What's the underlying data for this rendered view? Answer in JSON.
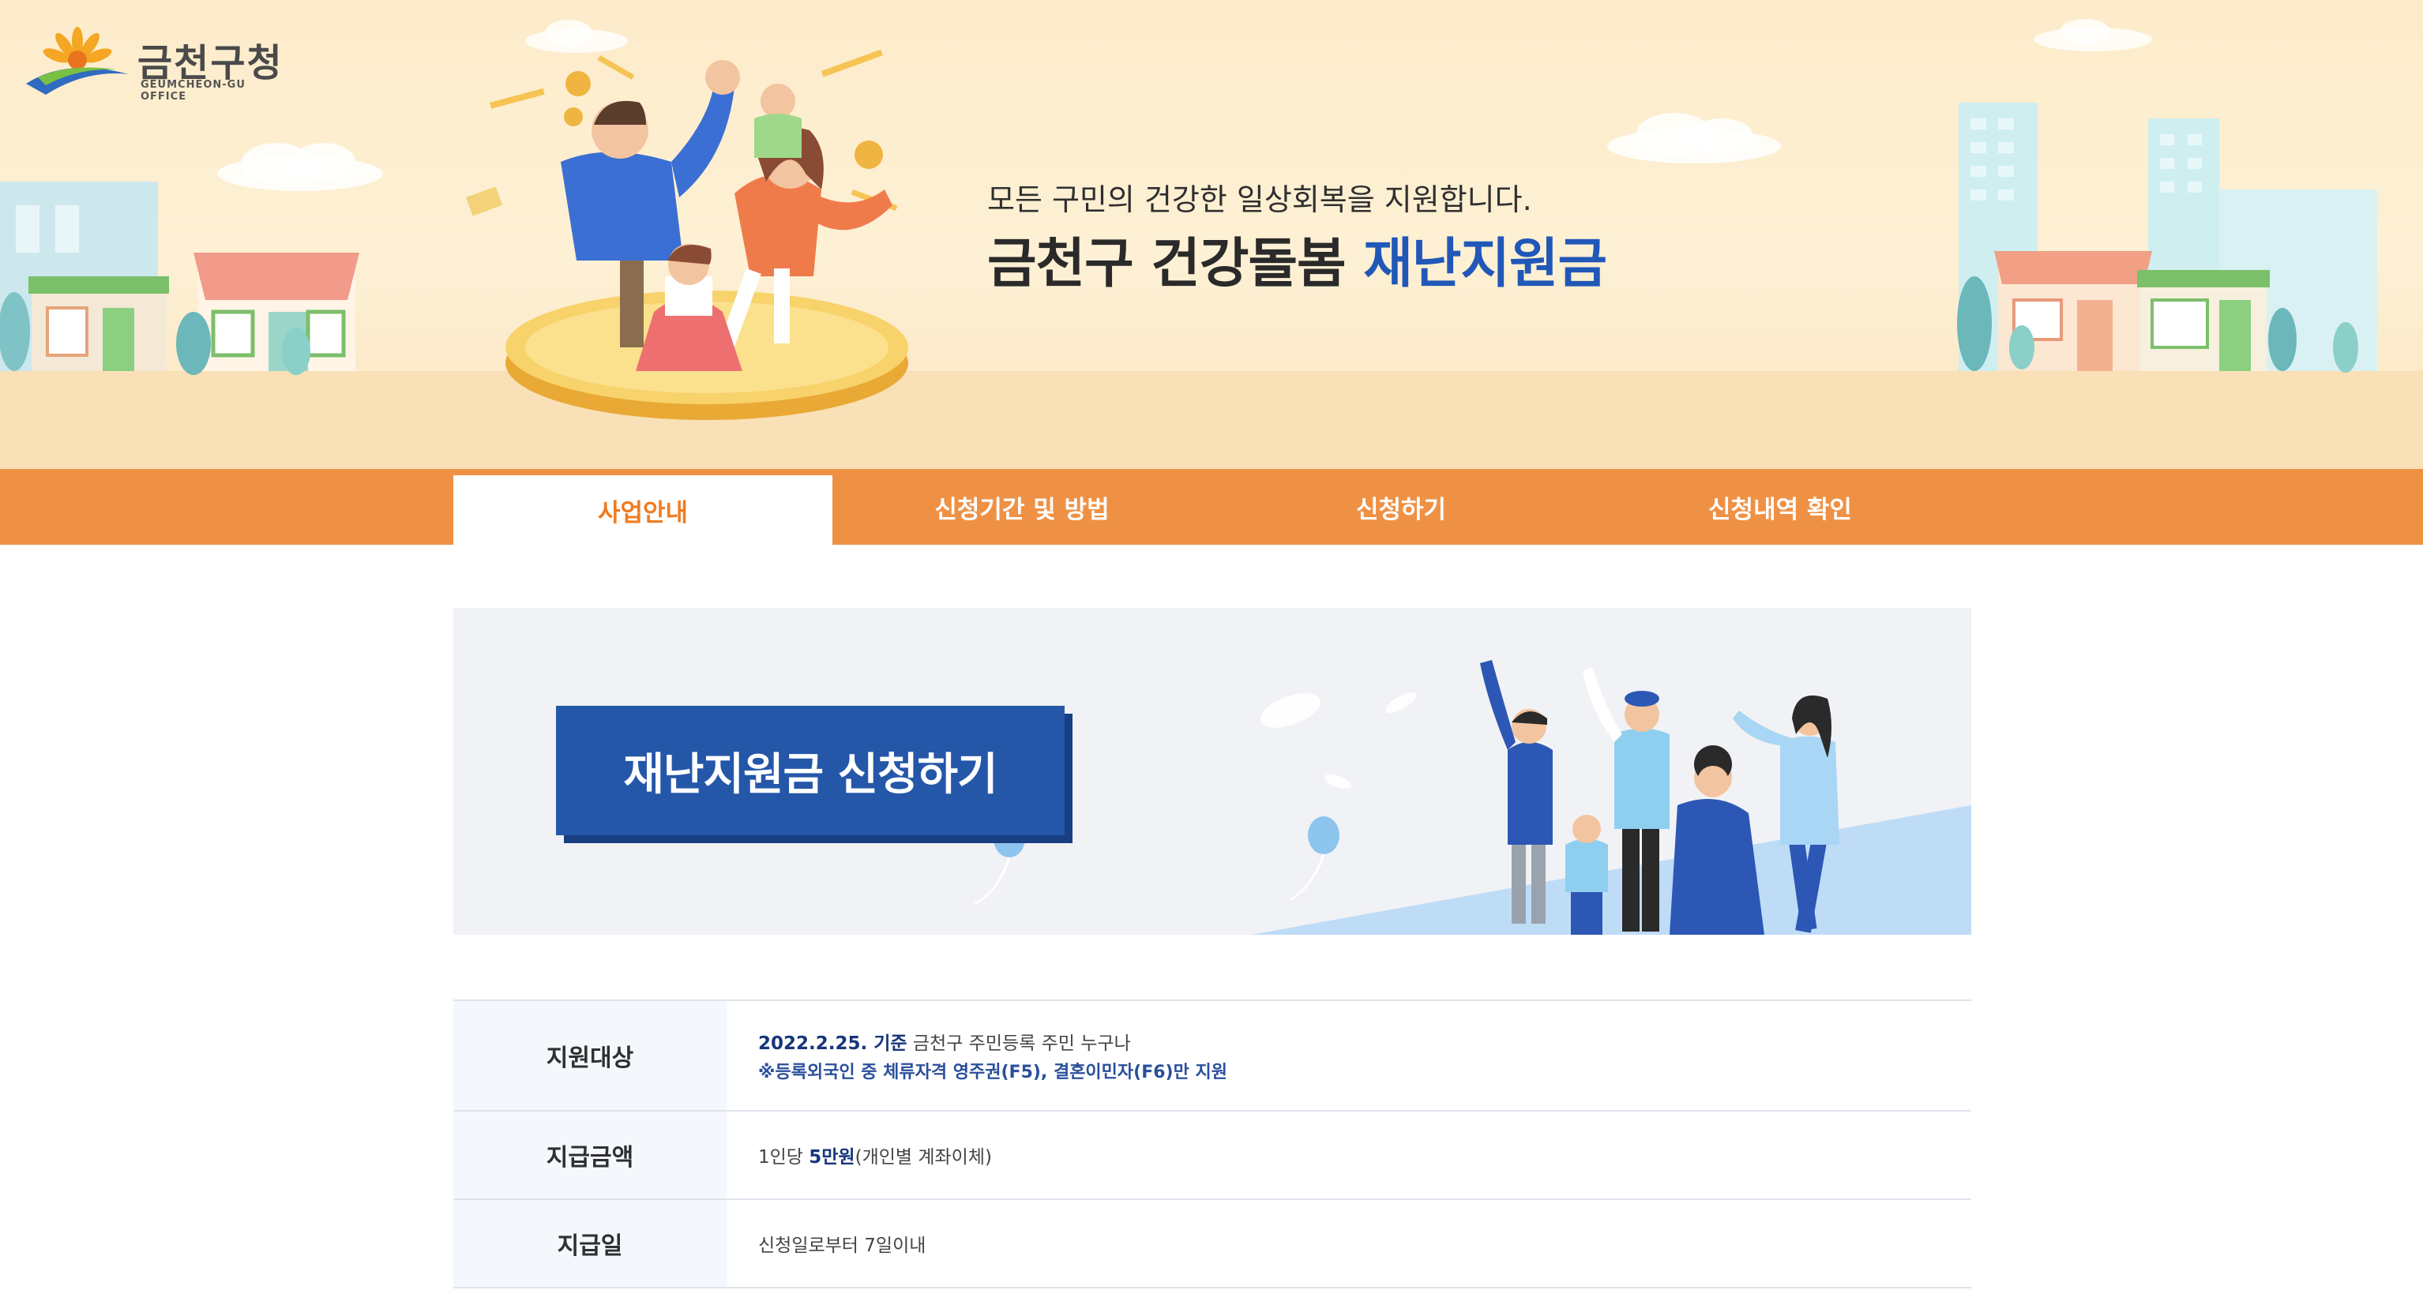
{
  "logo": {
    "title": "금천구청",
    "subtitle": "GEUMCHEON-GU OFFICE"
  },
  "hero": {
    "subtitle": "모든 구민의 건강한 일상회복을 지원합니다.",
    "title_prefix": "금천구 건강돌봄 ",
    "title_accent": "재난지원금"
  },
  "nav": {
    "tabs": [
      {
        "label": "사업안내",
        "active": true
      },
      {
        "label": "신청기간 및 방법",
        "active": false
      },
      {
        "label": "신청하기",
        "active": false
      },
      {
        "label": "신청내역 확인",
        "active": false
      }
    ]
  },
  "banner": {
    "apply_button": "재난지원금 신청하기"
  },
  "info": {
    "rows": [
      {
        "label": "지원대상",
        "line1_strong": "2022.2.25. 기준",
        "line1_rest": " 금천구 주민등록 주민 누구나",
        "line2": "※등록외국인 중 체류자격 영주권(F5), 결혼이민자(F6)만 지원"
      },
      {
        "label": "지급금액",
        "prefix": "1인당 ",
        "strong": "5만원",
        "suffix": "(개인별 계좌이체)"
      },
      {
        "label": "지급일",
        "value": "신청일로부터 7일이내"
      }
    ]
  },
  "colors": {
    "nav_bg": "#ef9145",
    "nav_active_text": "#ef7c22",
    "accent_blue": "#2158b8",
    "button_blue": "#2557a9",
    "hero_bg": "#fdeccb"
  }
}
